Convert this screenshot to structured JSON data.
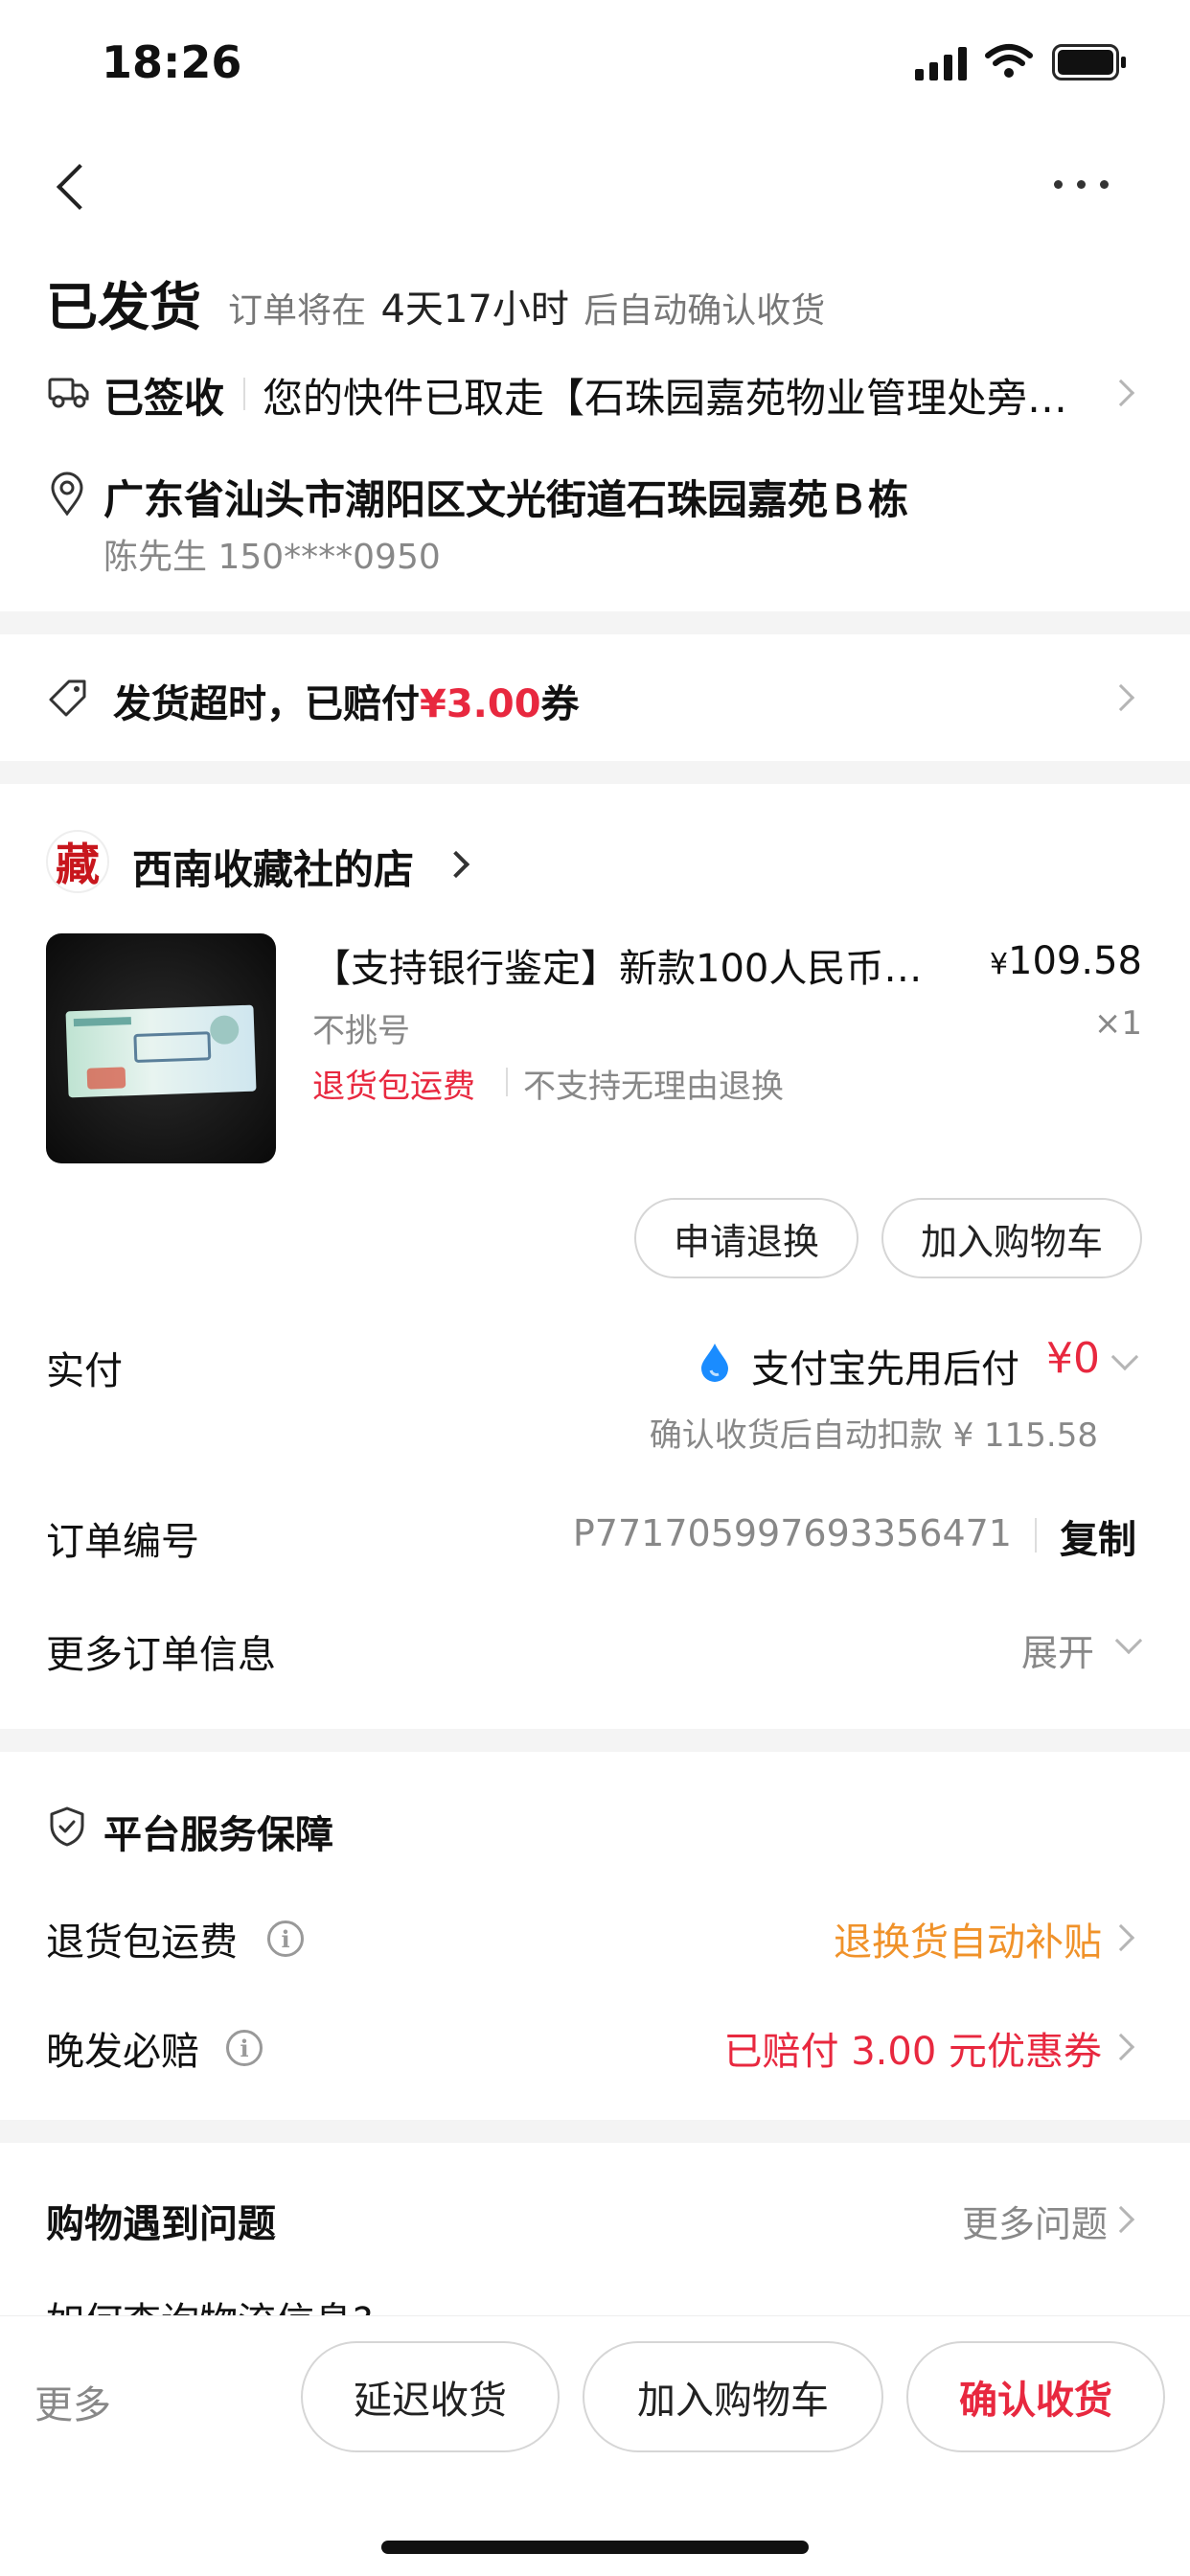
{
  "status_bar": {
    "time": "18:26"
  },
  "header": {
    "more_label": "···"
  },
  "order_status": {
    "title": "已发货",
    "auto_confirm_prefix": "订单将在",
    "auto_confirm_time": "4天17小时",
    "auto_confirm_suffix": "后自动确认收货"
  },
  "logistics": {
    "status": "已签收",
    "detail": "您的快件已取走【石珠园嘉苑物业管理处旁…"
  },
  "address": {
    "line": "广东省汕头市潮阳区文光街道石珠园嘉苑Ｂ栋",
    "contact": "陈先生 150****0950"
  },
  "compensation": {
    "prefix": "发货超时，已赔付",
    "amount": "¥3.00",
    "suffix": "券"
  },
  "shop": {
    "logo_char": "藏",
    "name": "西南收藏社的店"
  },
  "product": {
    "title": "【支持银行鉴定】新款100人民币…",
    "price_symbol": "¥",
    "price": "109.58",
    "spec": "不挑号",
    "quantity": "×1",
    "tag_return_shipping": "退货包运费",
    "tag_no_reason": "不支持无理由退换",
    "btn_refund": "申请退换",
    "btn_add_cart": "加入购物车"
  },
  "payment": {
    "label": "实付",
    "method": "支付宝先用后付",
    "amount": "¥0",
    "note": "确认收货后自动扣款 ¥ 115.58"
  },
  "order_number": {
    "label": "订单编号",
    "value": "P771705997693356471",
    "copy": "复制"
  },
  "more_info": {
    "label": "更多订单信息",
    "expand": "展开"
  },
  "guarantee": {
    "title": "平台服务保障",
    "items": [
      {
        "label": "退货包运费",
        "value": "退换货自动补贴",
        "color": "#f0922a"
      },
      {
        "label": "晚发必赔",
        "value": "已赔付 3.00 元优惠券",
        "color": "#e8283f"
      }
    ]
  },
  "problems": {
    "title": "购物遇到问题",
    "more": "更多问题",
    "first_question": "如何查询物流信息?"
  },
  "bottom_bar": {
    "more": "更多",
    "delay": "延迟收货",
    "add_cart": "加入购物车",
    "confirm": "确认收货"
  },
  "colors": {
    "accent_red": "#e8283f",
    "orange": "#f0922a",
    "gray_text": "#8a8a8a",
    "section_gap": "#f4f4f4",
    "alipay_blue": "#1a8cff"
  }
}
